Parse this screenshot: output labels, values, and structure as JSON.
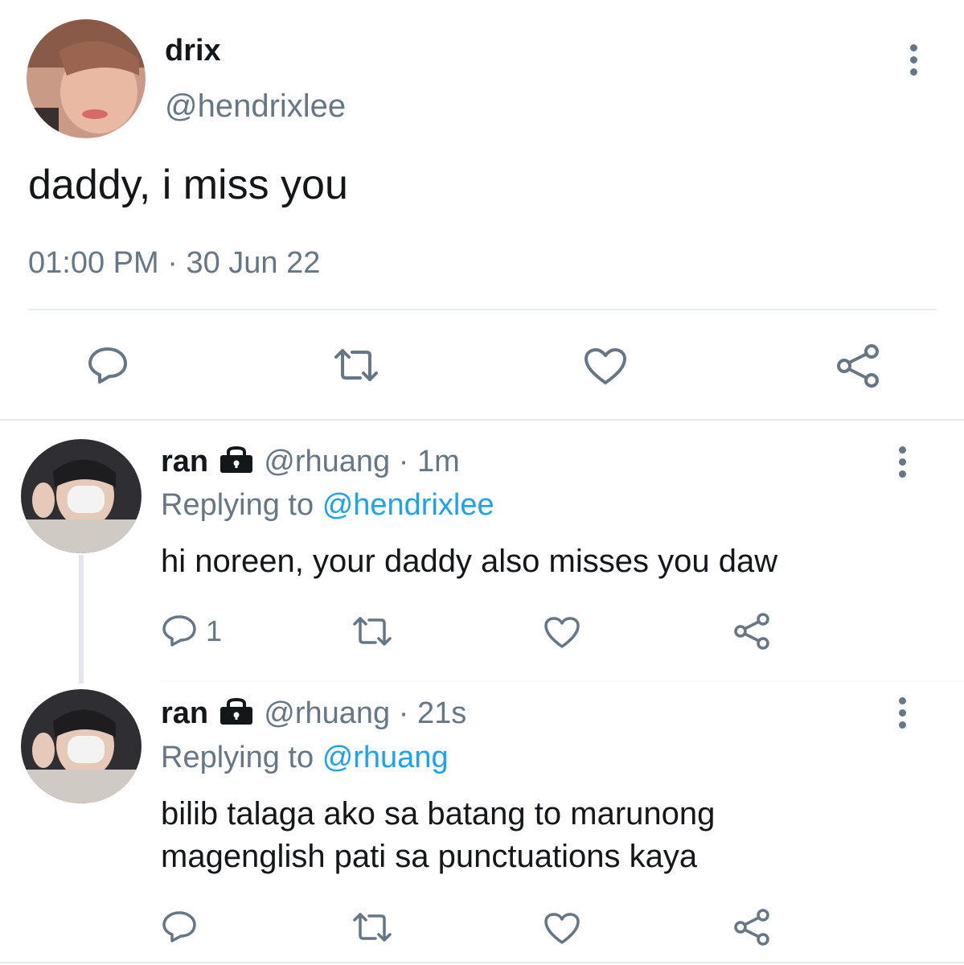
{
  "tweet": {
    "display_name": "drix",
    "handle": "@hendrixlee",
    "text": "daddy, i miss you",
    "time": "01:00 PM",
    "sep": "·",
    "date": "30 Jun 22"
  },
  "replies": [
    {
      "display_name": "ran",
      "handle": "@rhuang",
      "sep": "·",
      "age": "1m",
      "replying_label": "Replying to",
      "replying_to": "@hendrixlee",
      "text": "hi noreen, your daddy also misses you daw",
      "reply_count": "1"
    },
    {
      "display_name": "ran",
      "handle": "@rhuang",
      "sep": "·",
      "age": "21s",
      "replying_label": "Replying to",
      "replying_to": "@rhuang",
      "text_line1": "bilib talaga ako sa batang to marunong",
      "text_line2": "magenglish pati sa punctuations kaya",
      "reply_count": ""
    }
  ],
  "icons": {
    "reply": "comment-icon",
    "retweet": "retweet-icon",
    "like": "heart-icon",
    "share": "share-icon",
    "more": "more-vertical-icon",
    "lock": "lock-icon"
  },
  "colors": {
    "text": "#14171a",
    "muted": "#657786",
    "link": "#1da1f2",
    "divider": "#e6ecf0"
  }
}
